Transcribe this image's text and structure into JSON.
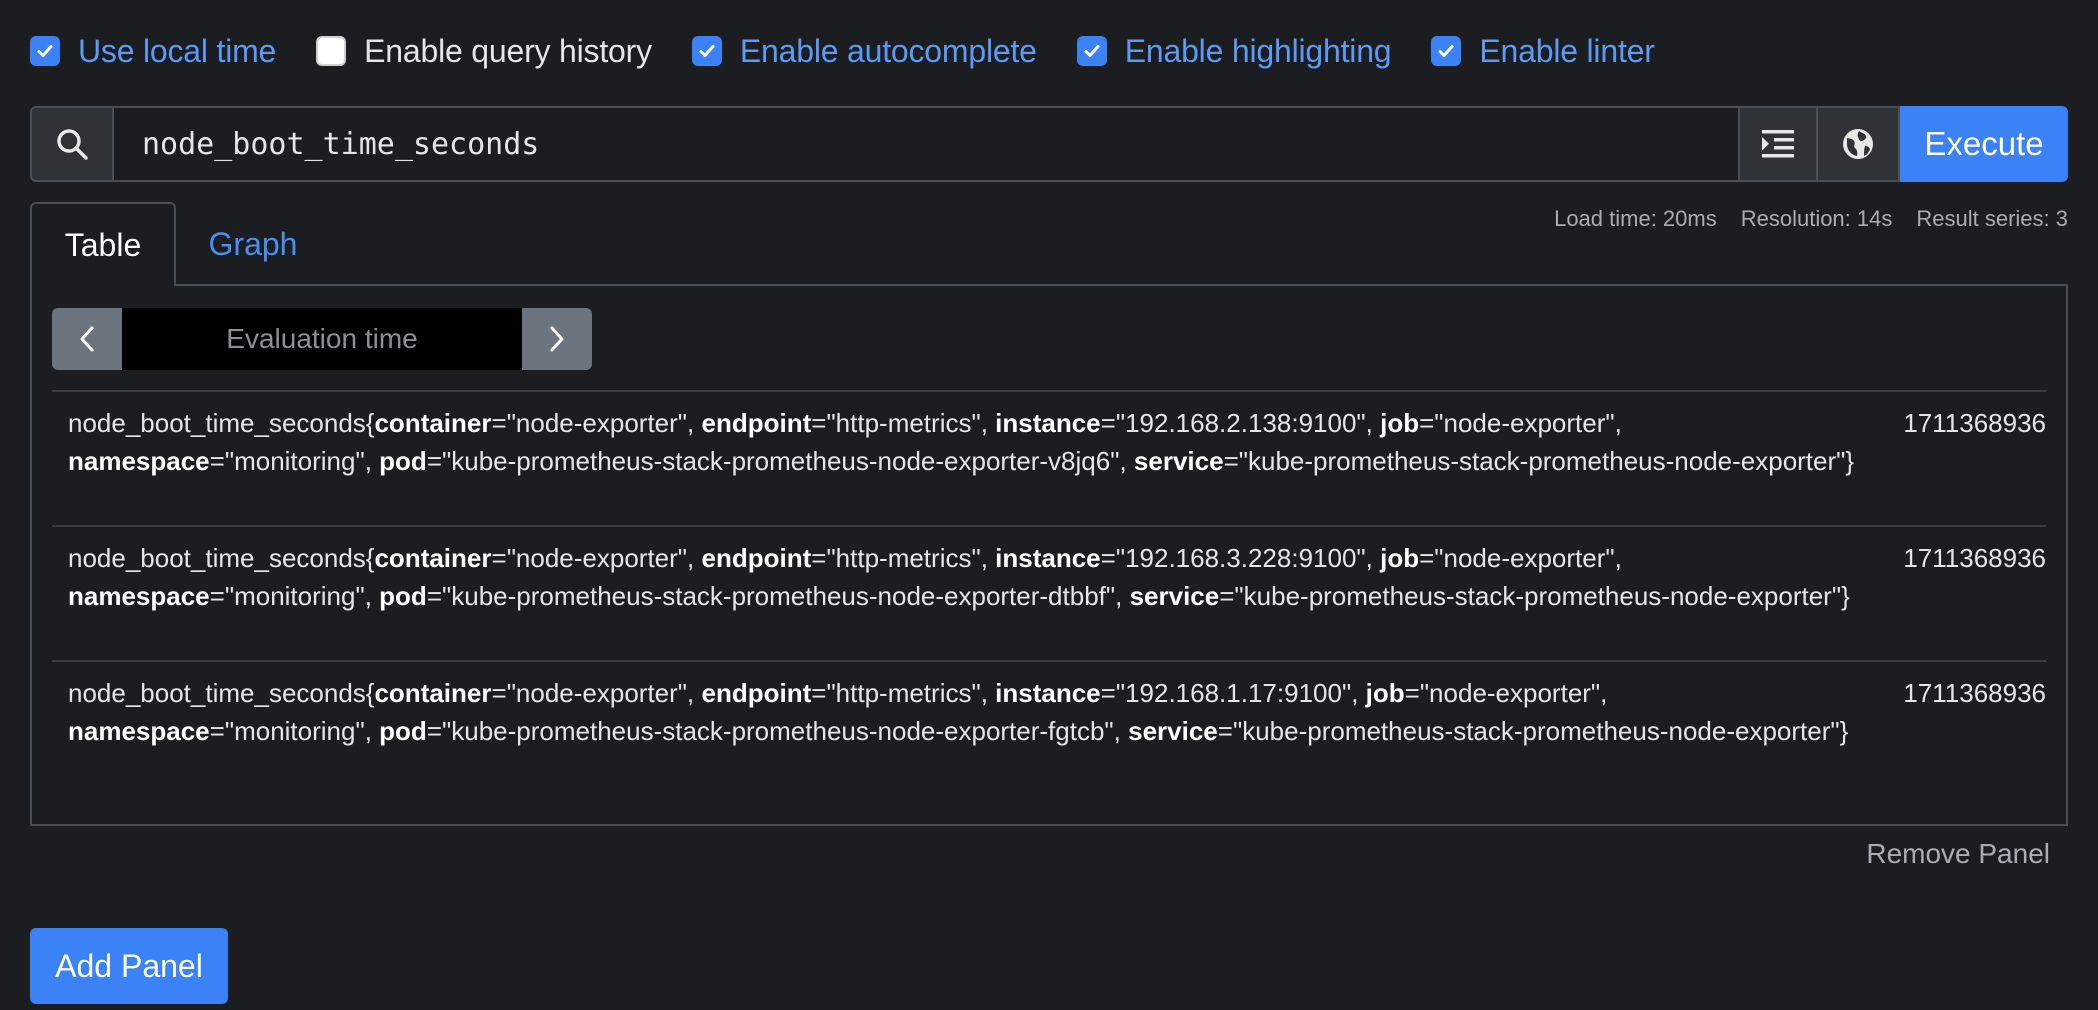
{
  "options": [
    {
      "label": "Use local time",
      "checked": true
    },
    {
      "label": "Enable query history",
      "checked": false
    },
    {
      "label": "Enable autocomplete",
      "checked": true
    },
    {
      "label": "Enable highlighting",
      "checked": true
    },
    {
      "label": "Enable linter",
      "checked": true
    }
  ],
  "query": {
    "expression": "node_boot_time_seconds",
    "execute_label": "Execute"
  },
  "tabs": {
    "table": "Table",
    "graph": "Graph",
    "active": "Table"
  },
  "stats": {
    "load_time": "Load time: 20ms",
    "resolution": "Resolution: 14s",
    "result_series": "Result series: 3"
  },
  "evaluation": {
    "placeholder": "Evaluation time"
  },
  "results": [
    {
      "metric": "node_boot_time_seconds",
      "labels": [
        {
          "key": "container",
          "value": "\"node-exporter\""
        },
        {
          "key": "endpoint",
          "value": "\"http-metrics\""
        },
        {
          "key": "instance",
          "value": "\"192.168.2.138:9100\""
        },
        {
          "key": "job",
          "value": "\"node-exporter\""
        },
        {
          "key": "namespace",
          "value": "\"monitoring\""
        },
        {
          "key": "pod",
          "value": "\"kube-prometheus-stack-prometheus-node-exporter-v8jq6\""
        },
        {
          "key": "service",
          "value": "\"kube-prometheus-stack-prometheus-node-exporter\""
        }
      ],
      "value": "1711368936"
    },
    {
      "metric": "node_boot_time_seconds",
      "labels": [
        {
          "key": "container",
          "value": "\"node-exporter\""
        },
        {
          "key": "endpoint",
          "value": "\"http-metrics\""
        },
        {
          "key": "instance",
          "value": "\"192.168.3.228:9100\""
        },
        {
          "key": "job",
          "value": "\"node-exporter\""
        },
        {
          "key": "namespace",
          "value": "\"monitoring\""
        },
        {
          "key": "pod",
          "value": "\"kube-prometheus-stack-prometheus-node-exporter-dtbbf\""
        },
        {
          "key": "service",
          "value": "\"kube-prometheus-stack-prometheus-node-exporter\""
        }
      ],
      "value": "1711368936"
    },
    {
      "metric": "node_boot_time_seconds",
      "labels": [
        {
          "key": "container",
          "value": "\"node-exporter\""
        },
        {
          "key": "endpoint",
          "value": "\"http-metrics\""
        },
        {
          "key": "instance",
          "value": "\"192.168.1.17:9100\""
        },
        {
          "key": "job",
          "value": "\"node-exporter\""
        },
        {
          "key": "namespace",
          "value": "\"monitoring\""
        },
        {
          "key": "pod",
          "value": "\"kube-prometheus-stack-prometheus-node-exporter-fgtcb\""
        },
        {
          "key": "service",
          "value": "\"kube-prometheus-stack-prometheus-node-exporter\""
        }
      ],
      "value": "1711368936"
    }
  ],
  "panel_actions": {
    "remove_panel": "Remove Panel",
    "add_panel": "Add Panel"
  },
  "icons": {
    "search": "search-icon",
    "format": "format-indent-icon",
    "metrics_explorer": "globe-icon",
    "prev": "chevron-left-icon",
    "next": "chevron-right-icon",
    "checkbox": "checkmark-icon"
  },
  "colors": {
    "background": "#1b1d21",
    "accent": "#3b82f6",
    "link": "#5b9bf5",
    "border": "#4a4e55",
    "muted": "#a9adb3"
  }
}
